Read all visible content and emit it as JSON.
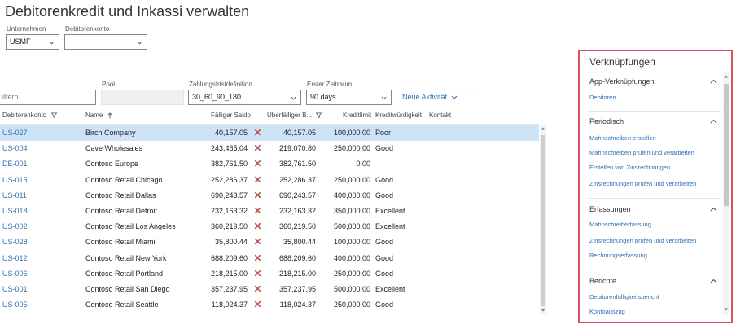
{
  "page_title": "Debitorenkredit und Inkassi verwalten",
  "company": {
    "label": "Unternehmen",
    "value": "USMF"
  },
  "customer_account": {
    "label": "Debitorenkonto",
    "value": ""
  },
  "filter": {
    "placeholder": "iltern"
  },
  "pool": {
    "label": "Pool",
    "value": ""
  },
  "terms": {
    "label": "Zahlungsfristdefinition",
    "value": "30_60_90_180"
  },
  "first_period": {
    "label": "Erster Zeitraum",
    "value": "90 days"
  },
  "new_activity": "Neue Aktivität",
  "more": "···",
  "columns": {
    "account": "Debitorenkonto",
    "name": "Name",
    "due": "Fälliger Saldo",
    "overdue": "Überfälliger B...",
    "limit": "Kreditlimit",
    "credit": "Kreditwürdigkeit",
    "contact": "Kontakt"
  },
  "rows": [
    {
      "account": "US-027",
      "name": "Birch Company",
      "due": "40,157.05",
      "overdue": "40,157.05",
      "limit": "100,000.00",
      "credit": "Poor"
    },
    {
      "account": "US-004",
      "name": "Cave Wholesales",
      "due": "243,465.04",
      "overdue": "219,070.80",
      "limit": "250,000.00",
      "credit": "Good"
    },
    {
      "account": "DE-001",
      "name": "Contoso Europe",
      "due": "382,761.50",
      "overdue": "382,761.50",
      "limit": "0.00",
      "credit": ""
    },
    {
      "account": "US-015",
      "name": "Contoso Retail Chicago",
      "due": "252,286.37",
      "overdue": "252,286.37",
      "limit": "250,000.00",
      "credit": "Good"
    },
    {
      "account": "US-011",
      "name": "Contoso Retail Dallas",
      "due": "690,243.57",
      "overdue": "690,243.57",
      "limit": "400,000.00",
      "credit": "Good"
    },
    {
      "account": "US-018",
      "name": "Contoso Retail Detroit",
      "due": "232,163.32",
      "overdue": "232,163.32",
      "limit": "350,000.00",
      "credit": "Excellent"
    },
    {
      "account": "US-002",
      "name": "Contoso Retail Los Angeles",
      "due": "360,219.50",
      "overdue": "360,219.50",
      "limit": "500,000.00",
      "credit": "Excellent"
    },
    {
      "account": "US-028",
      "name": "Contoso Retail Miami",
      "due": "35,800.44",
      "overdue": "35,800.44",
      "limit": "100,000.00",
      "credit": "Good"
    },
    {
      "account": "US-012",
      "name": "Contoso Retail New York",
      "due": "688,209.60",
      "overdue": "688,209.60",
      "limit": "400,000.00",
      "credit": "Good"
    },
    {
      "account": "US-006",
      "name": "Contoso Retail Portland",
      "due": "218,215.00",
      "overdue": "218,215.00",
      "limit": "250,000.00",
      "credit": "Good"
    },
    {
      "account": "US-001",
      "name": "Contoso Retail San Diego",
      "due": "357,237.95",
      "overdue": "357,237.95",
      "limit": "500,000.00",
      "credit": "Excellent"
    },
    {
      "account": "US-005",
      "name": "Contoso Retail Seattle",
      "due": "118,024.37",
      "overdue": "118,024.37",
      "limit": "250,000.00",
      "credit": "Good"
    }
  ],
  "panel": {
    "title": "Verknüpfungen",
    "sections": [
      {
        "title": "App-Verknüpfungen",
        "links": [
          "Debitoren"
        ]
      },
      {
        "title": "Periodisch",
        "links": [
          "Mahnschreiben erstellen",
          "Mahnschreiben prüfen und verarbeiten",
          "Erstellen von Zinsrechnungen",
          "Zinsrechnungen prüfen und verarbeiten"
        ]
      },
      {
        "title": "Erfassungen",
        "links": [
          "Mahnschreiberfassung",
          "Zinsrechnungen prüfen und verarbeiten",
          "Rechnungserfassung"
        ]
      },
      {
        "title": "Berichte",
        "links": [
          "Debitorenfälligkeitsbericht",
          "Kontoauszug"
        ]
      }
    ]
  },
  "colors": {
    "accent": "#2c6fb5",
    "selected_row": "#cfe3f6",
    "panel_border": "#d9535f",
    "x_mark": "#c0504d"
  },
  "icons": {
    "dropdown": "chevron-down-icon",
    "collapse": "chevron-up-icon",
    "filter": "funnel-icon",
    "sort": "arrow-up-icon",
    "status": "x-mark-icon"
  }
}
